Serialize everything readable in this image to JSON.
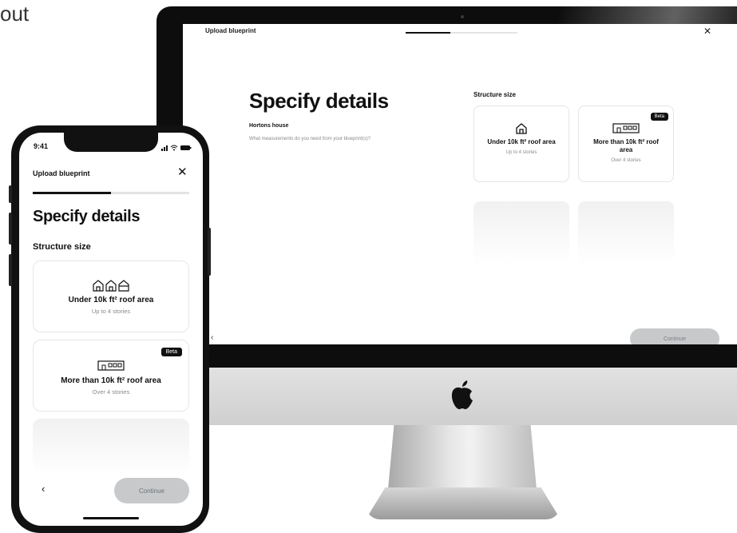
{
  "corner_text": "out",
  "colors": {
    "accent": "#111111",
    "button_disabled": "#c7c9cb",
    "muted_text": "#8a8a8a",
    "border": "#e4e4e4"
  },
  "desktop": {
    "window_title": "Upload blueprint",
    "progress": 0.4,
    "close_icon": "close-icon",
    "heading": "Specify details",
    "project_name": "Hortons house",
    "question": "What measurements do you need from your blueprint(s)?",
    "section_label": "Structure size",
    "options": [
      {
        "title": "Under 10k ft² roof area",
        "subtitle": "Up to 4 stories",
        "icon": "house-icon",
        "badge": ""
      },
      {
        "title": "More than 10k ft² roof area",
        "subtitle": "Over 4 stories",
        "icon": "building-icon",
        "badge": "Beta"
      }
    ],
    "back_icon": "chevron-left-icon",
    "continue_label": "Continue"
  },
  "phone": {
    "status_time": "9:41",
    "header_title": "Upload blueprint",
    "progress": 0.5,
    "heading": "Specify details",
    "section_label": "Structure size",
    "options": [
      {
        "title": "Under 10k ft² roof area",
        "subtitle": "Up to 4 stories",
        "icon": "houses-icon",
        "badge": ""
      },
      {
        "title": "More than 10k ft² roof area",
        "subtitle": "Over 4 stories",
        "icon": "building-icon",
        "badge": "Beta"
      }
    ],
    "continue_label": "Continue"
  }
}
